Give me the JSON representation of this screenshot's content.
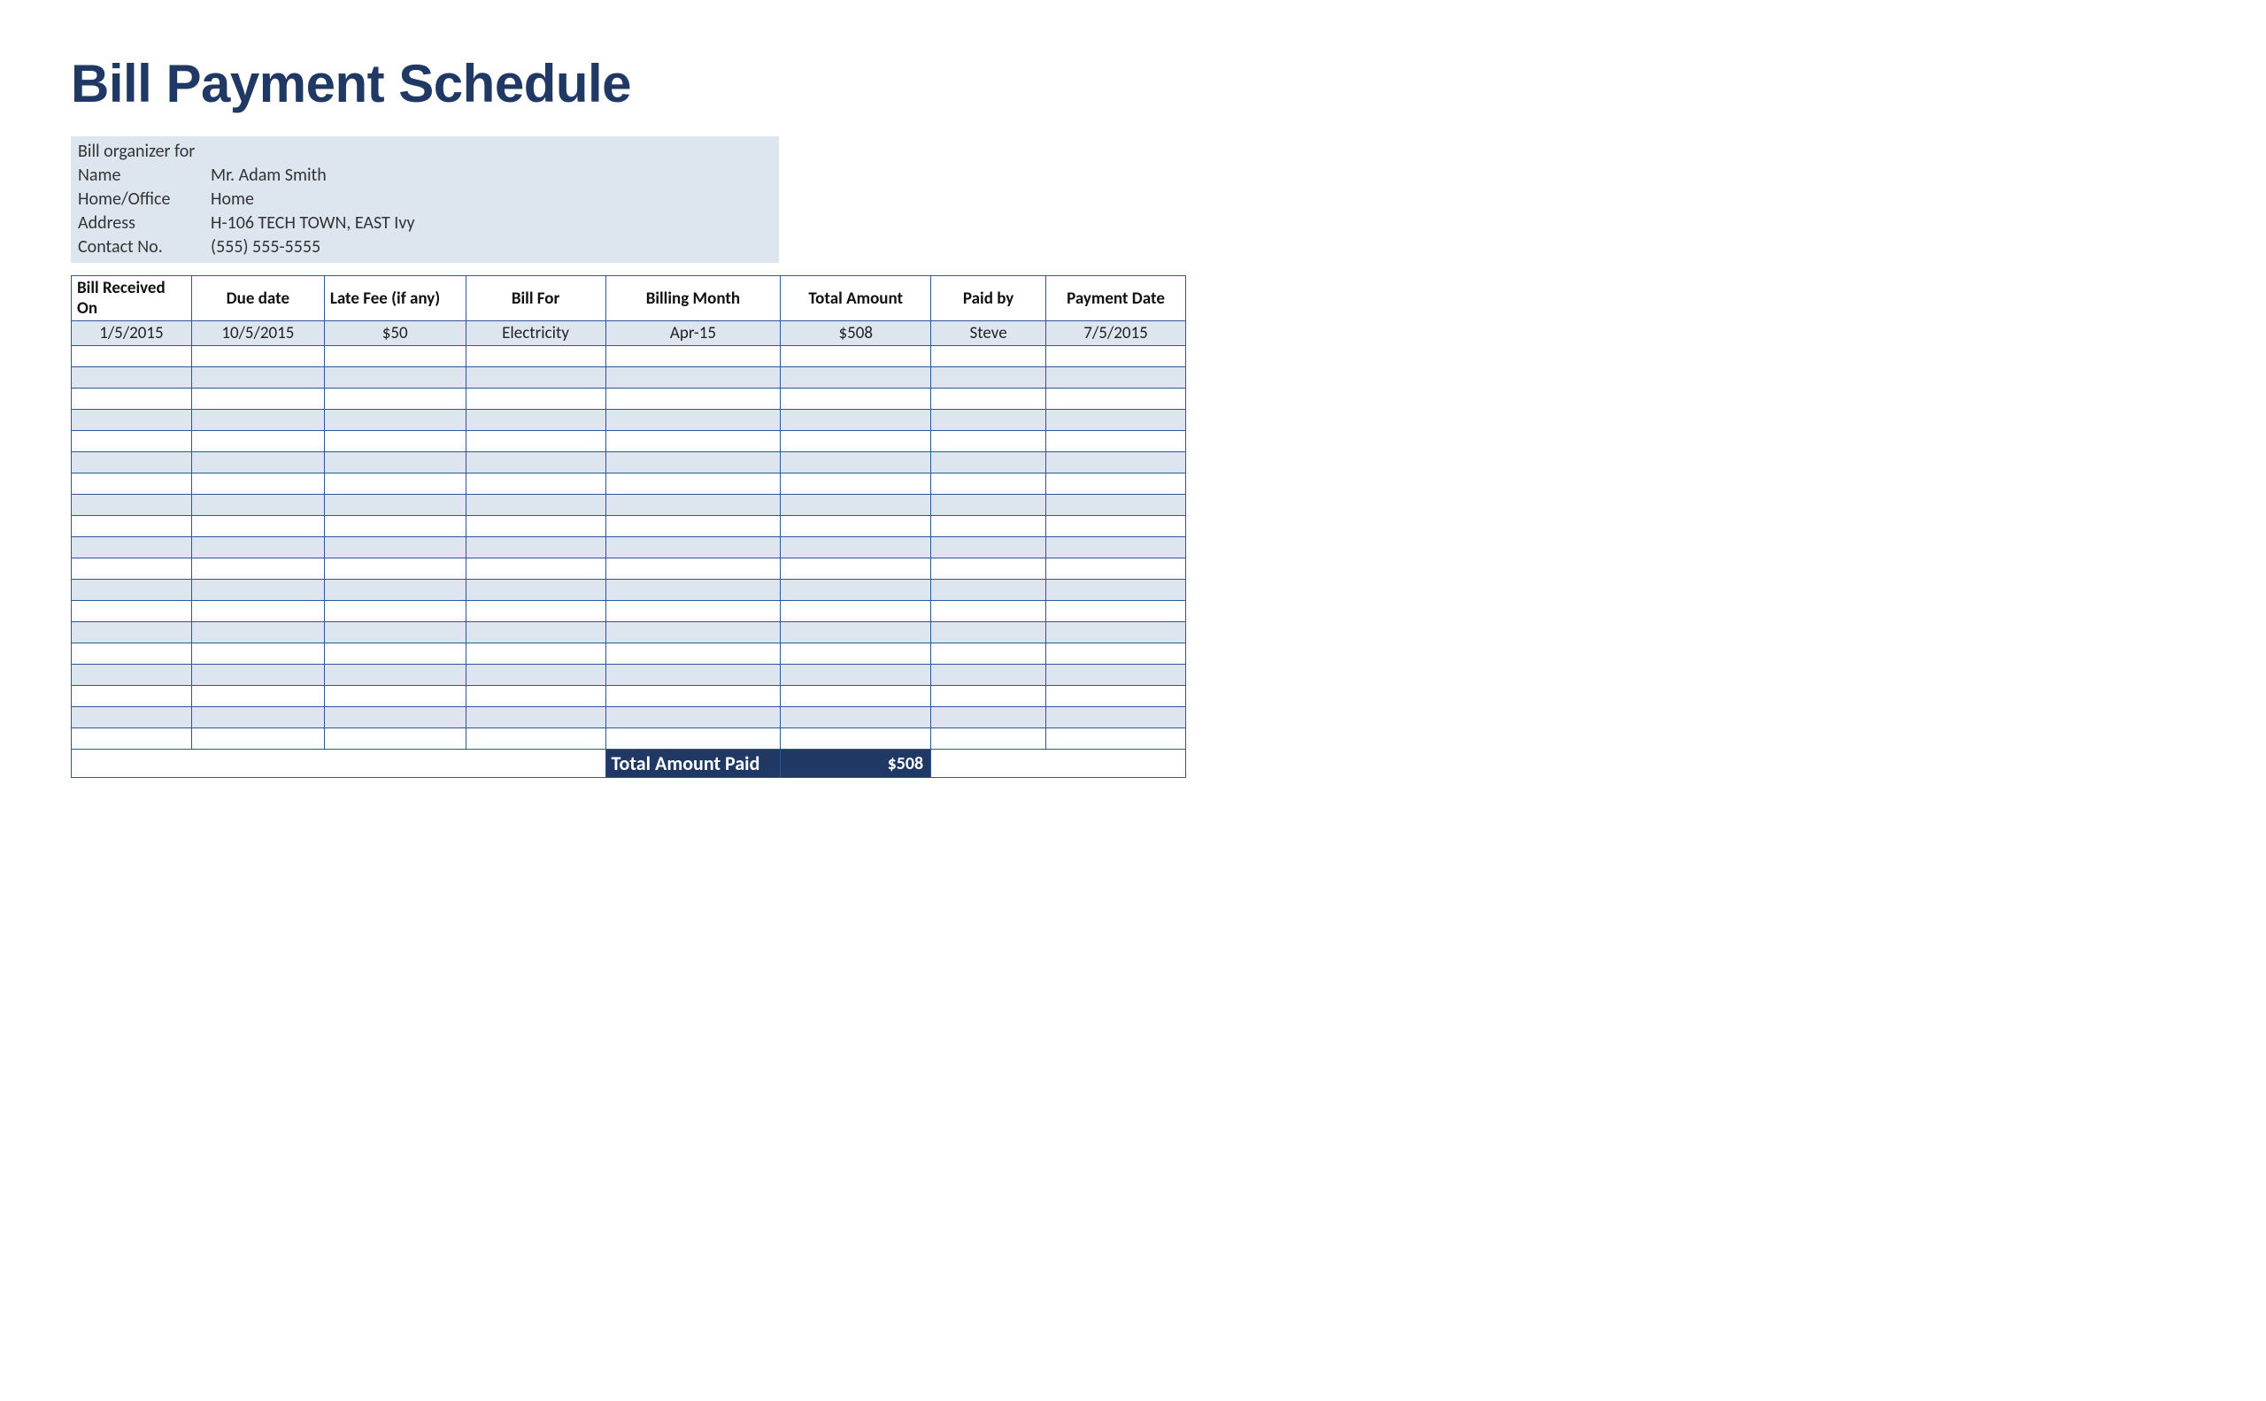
{
  "title": "Bill Payment Schedule",
  "info": {
    "heading": "Bill organizer for",
    "labels": {
      "name": "Name",
      "home_office": "Home/Office",
      "address": "Address",
      "contact": "Contact No."
    },
    "values": {
      "name": "Mr. Adam Smith",
      "home_office": "Home",
      "address": "H-106 TECH TOWN, EAST Ivy",
      "contact": "(555) 555-5555"
    }
  },
  "columns": [
    "Bill Received On",
    "Due date",
    "Late Fee (if any)",
    "Bill For",
    "Billing Month",
    "Total Amount",
    "Paid by",
    "Payment Date"
  ],
  "rows": [
    {
      "received": "1/5/2015",
      "due": "10/5/2015",
      "late_fee": "$50",
      "bill_for": "Electricity",
      "month": "Apr-15",
      "total": "$508",
      "paid_by": "Steve",
      "paid_date": "7/5/2015"
    },
    {},
    {},
    {},
    {},
    {},
    {},
    {},
    {},
    {},
    {},
    {},
    {},
    {},
    {},
    {},
    {},
    {},
    {},
    {}
  ],
  "footer": {
    "label": "Total Amount Paid",
    "value": "$508"
  }
}
